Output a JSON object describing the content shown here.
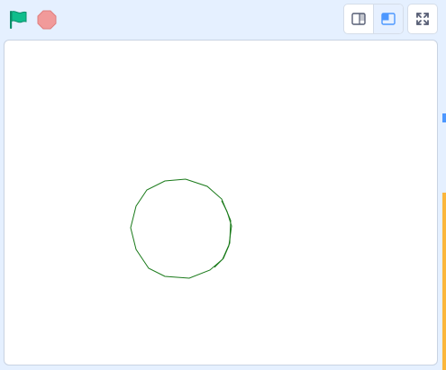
{
  "toolbar": {
    "green_flag_icon": "green-flag-icon",
    "stop_icon": "stop-sign-icon",
    "small_stage_icon": "small-stage-icon",
    "normal_stage_icon": "normal-stage-icon",
    "fullscreen_icon": "fullscreen-icon"
  },
  "colors": {
    "background": "#e5f0ff",
    "flag_green": "#0fbd8c",
    "stop_red": "#ec5959",
    "accent_blue": "#4c97ff",
    "pen_green": "#1a7a1a"
  },
  "stage": {
    "drawing": "pen-circle"
  }
}
